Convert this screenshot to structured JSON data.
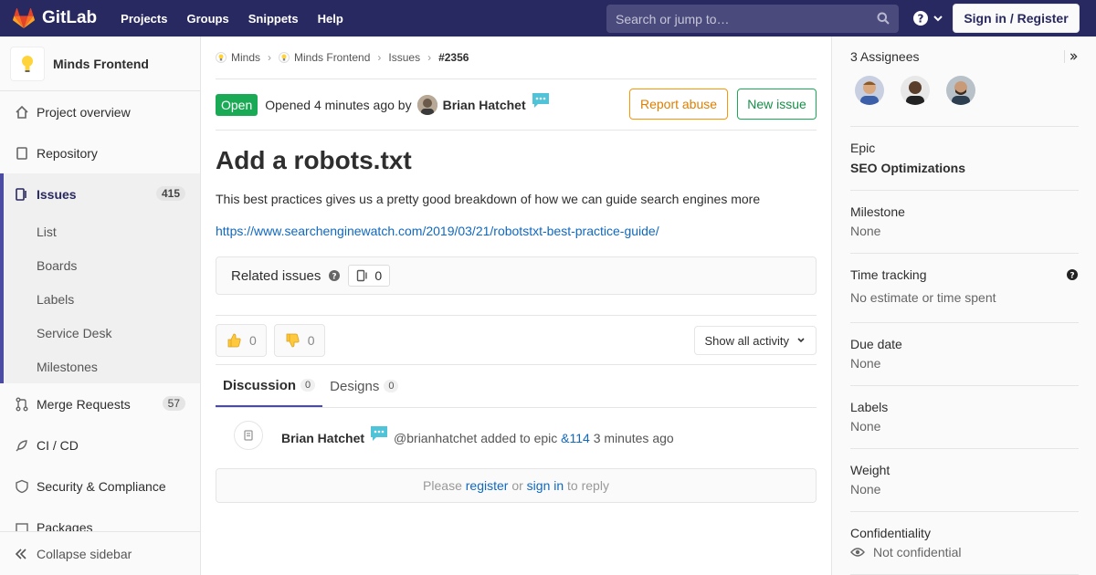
{
  "nav": {
    "brand": "GitLab",
    "links": [
      "Projects",
      "Groups",
      "Snippets",
      "Help"
    ],
    "search_placeholder": "Search or jump to…",
    "signin": "Sign in / Register"
  },
  "sidebar": {
    "project": "Minds Frontend",
    "items": [
      {
        "label": "Project overview",
        "icon": "home-icon"
      },
      {
        "label": "Repository",
        "icon": "doc-icon"
      },
      {
        "label": "Issues",
        "icon": "issues-icon",
        "count": "415"
      },
      {
        "label": "Merge Requests",
        "icon": "merge-icon",
        "count": "57"
      },
      {
        "label": "CI / CD",
        "icon": "rocket-icon"
      },
      {
        "label": "Security & Compliance",
        "icon": "shield-icon"
      },
      {
        "label": "Packages",
        "icon": "package-icon"
      }
    ],
    "sub_items": [
      "List",
      "Boards",
      "Labels",
      "Service Desk",
      "Milestones"
    ],
    "collapse": "Collapse sidebar"
  },
  "breadcrumb": [
    "Minds",
    "Minds Frontend",
    "Issues",
    "#2356"
  ],
  "issue": {
    "status": "Open",
    "opened": "Opened 4 minutes ago by",
    "author": "Brian Hatchet",
    "report_abuse": "Report abuse",
    "new_issue": "New issue",
    "title": "Add a robots.txt",
    "description": "This best practices gives us a pretty good breakdown of how we can guide search engines more",
    "link": "https://www.searchenginewatch.com/2019/03/21/robotstxt-best-practice-guide/",
    "related_label": "Related issues",
    "related_count": "0",
    "thumbs_up": "0",
    "thumbs_down": "0",
    "activity": "Show all activity"
  },
  "tabs": [
    {
      "label": "Discussion",
      "count": "0"
    },
    {
      "label": "Designs",
      "count": "0"
    }
  ],
  "note": {
    "author": "Brian Hatchet",
    "handle": "@brianhatchet",
    "action": "added to epic",
    "epic_ref": "&114",
    "time": "3 minutes ago"
  },
  "reply": {
    "please": "Please",
    "register": "register",
    "or": "or",
    "sign_in": "sign in",
    "to_reply": "to reply"
  },
  "right_sidebar": {
    "assignees": "3 Assignees",
    "epic_label": "Epic",
    "epic_value": "SEO Optimizations",
    "milestone_label": "Milestone",
    "milestone_value": "None",
    "time_label": "Time tracking",
    "time_value": "No estimate or time spent",
    "due_label": "Due date",
    "due_value": "None",
    "labels_label": "Labels",
    "labels_value": "None",
    "weight_label": "Weight",
    "weight_value": "None",
    "conf_label": "Confidentiality",
    "conf_value": "Not confidential"
  },
  "colors": {
    "navbar": "#292961",
    "open": "#1aaa55",
    "link": "#1068bf",
    "abuse": "#fc9403"
  }
}
